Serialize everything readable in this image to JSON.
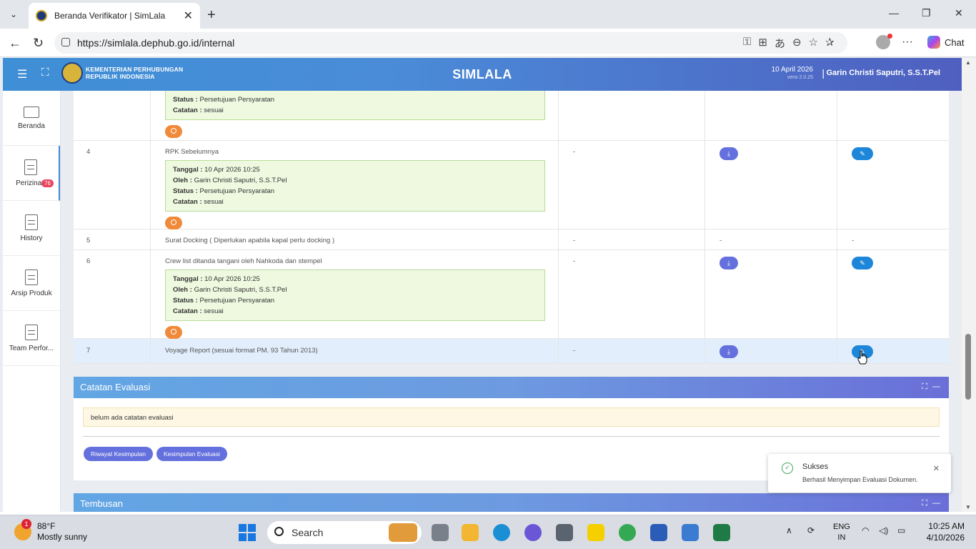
{
  "browser": {
    "tab_title": "Beranda Verifikator | SimLala",
    "url": "https://simlala.dephub.go.id/internal",
    "chat_label": "Chat"
  },
  "header": {
    "org_line1": "KEMENTERIAN PERHUBUNGAN",
    "org_line2": "REPUBLIK INDONESIA",
    "app_title": "SIMLALA",
    "date": "10 April 2026",
    "version": "versi 2.0.25",
    "separator": "|",
    "user": "Garin Christi Saputri, S.S.T.Pel"
  },
  "sidebar": {
    "items": [
      {
        "label": "Beranda"
      },
      {
        "label": "Perizinan",
        "badge": "76"
      },
      {
        "label": "History"
      },
      {
        "label": "Arsip Produk"
      },
      {
        "label": "Team Perfor..."
      }
    ]
  },
  "table": {
    "partial_row": {
      "status_label": "Status",
      "status": "Persetujuan Persyaratan",
      "note_label": "Catatan",
      "note": "sesuai"
    },
    "rows": [
      {
        "no": "4",
        "doc": "RPK Sebelumnya",
        "category": "-",
        "info": {
          "tanggal_label": "Tanggal",
          "tanggal": "10 Apr 2026 10:25",
          "oleh_label": "Oleh",
          "oleh": "Garin Christi Saputri, S.S.T.Pel",
          "status_label": "Status",
          "status": "Persetujuan Persyaratan",
          "catatan_label": "Catatan",
          "catatan": "sesuai"
        }
      },
      {
        "no": "5",
        "doc": "Surat Docking ( Diperlukan apabila kapal perlu docking )",
        "category": "-",
        "download": "-",
        "action": "-"
      },
      {
        "no": "6",
        "doc": "Crew list ditanda tangani oleh Nahkoda dan stempel",
        "category": "-",
        "info": {
          "tanggal_label": "Tanggal",
          "tanggal": "10 Apr 2026 10:25",
          "oleh_label": "Oleh",
          "oleh": "Garin Christi Saputri, S.S.T.Pel",
          "status_label": "Status",
          "status": "Persetujuan Persyaratan",
          "catatan_label": "Catatan",
          "catatan": "sesuai"
        }
      },
      {
        "no": "7",
        "doc": "Voyage Report (sesuai format PM. 93 Tahun 2013)",
        "category": "-"
      }
    ]
  },
  "evaluation_panel": {
    "title": "Catatan Evaluasi",
    "note": "belum ada catatan evaluasi",
    "btn_history": "Riwayat Kesimpulan",
    "btn_conclusion": "Kesimpulan Evaluasi"
  },
  "cc_panel": {
    "title": "Tembusan"
  },
  "toast": {
    "title": "Sukses",
    "message": "Berhasil Menyimpan Evaluasi Dokumen."
  },
  "taskbar": {
    "weather_badge": "1",
    "temp": "88°F",
    "condition": "Mostly sunny",
    "search_placeholder": "Search",
    "lang1": "ENG",
    "lang2": "IN",
    "time": "10:25 AM",
    "date": "4/10/2026"
  }
}
